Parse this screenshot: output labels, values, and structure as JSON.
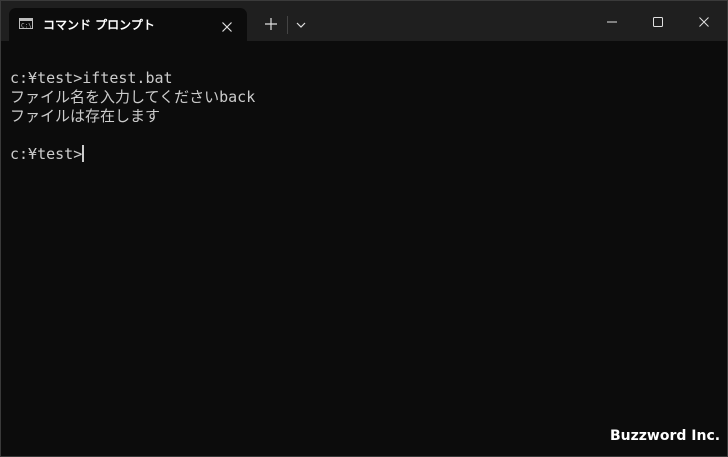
{
  "tab": {
    "title": "コマンド プロンプト",
    "icon": "terminal-icon"
  },
  "titlebar": {
    "new_tab_icon": "plus-icon",
    "dropdown_icon": "chevron-down-icon",
    "minimize_icon": "minimize-icon",
    "maximize_icon": "maximize-icon",
    "close_icon": "close-icon"
  },
  "terminal": {
    "lines": [
      "c:¥test>iftest.bat",
      "ファイル名を入力してくださいback",
      "ファイルは存在します",
      "",
      "c:¥test>"
    ]
  },
  "watermark": "Buzzword Inc.",
  "colors": {
    "background": "#0c0c0c",
    "titlebar": "#1f1f1f",
    "text": "#cccccc"
  }
}
